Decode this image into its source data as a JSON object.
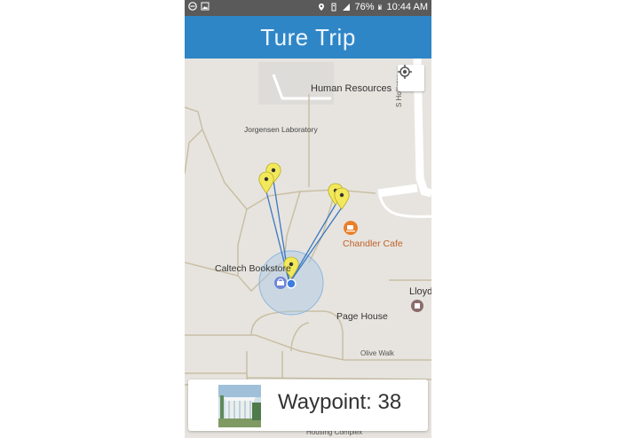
{
  "status_bar": {
    "battery": "76%",
    "time": "10:44 AM"
  },
  "app": {
    "title": "Ture Trip"
  },
  "map": {
    "labels": {
      "human_resources": "Human Resources",
      "jorgensen": "Jorgensen Laboratory",
      "hollistor": "S Hollistor",
      "chandler": "Chandler Cafe",
      "bookstore": "Caltech Bookstore",
      "lloyd": "Lloyd",
      "page_house": "Page House",
      "olive_walk": "Olive Walk",
      "housing": "Housing Complex"
    }
  },
  "card": {
    "waypoint_label": "Waypoint: 38"
  },
  "colors": {
    "app_bar": "#2f86c6",
    "status_bar": "#5a5a5a",
    "marker": "#f2e85a",
    "route": "#3b78c2",
    "poi_orange": "#e8802a",
    "poi_brown": "#8a6d6b"
  }
}
